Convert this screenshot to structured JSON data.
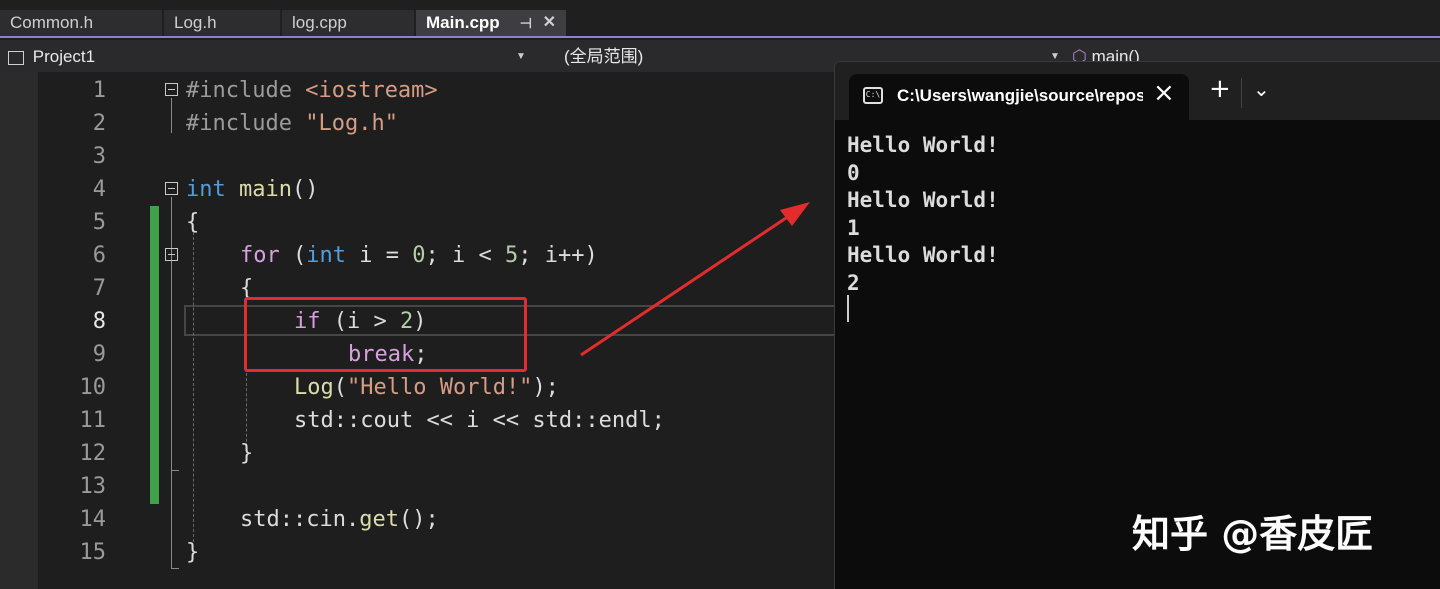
{
  "tabs": [
    {
      "label": "Common.h",
      "active": false
    },
    {
      "label": "Log.h",
      "active": false
    },
    {
      "label": "log.cpp",
      "active": false
    },
    {
      "label": "Main.cpp",
      "active": true
    }
  ],
  "nav": {
    "project": "Project1",
    "scope": "(全局范围)",
    "function": "main()"
  },
  "editor": {
    "line_numbers": [
      "1",
      "2",
      "3",
      "4",
      "5",
      "6",
      "7",
      "8",
      "9",
      "10",
      "11",
      "12",
      "13",
      "14",
      "15"
    ],
    "current_line": "8",
    "lines": {
      "l1": {
        "directive": "#include",
        "path": "<iostream>"
      },
      "l2": {
        "directive": "#include",
        "path": "\"Log.h\""
      },
      "l4": {
        "type": "int",
        "name": "main",
        "parens": "()"
      },
      "l5": {
        "brace": "{"
      },
      "l6": {
        "kw": "for",
        "open": "(",
        "type": "int",
        "rest1": " i = ",
        "n0": "0",
        "rest2": "; i < ",
        "n5": "5",
        "rest3": "; i++)"
      },
      "l7": {
        "brace": "{"
      },
      "l8": {
        "kw": "if",
        "rest1": " (i > ",
        "n2": "2",
        "close": ")"
      },
      "l9": {
        "kw": "break",
        "semi": ";"
      },
      "l10": {
        "fn": "Log",
        "open": "(",
        "str": "\"Hello World!\"",
        "close": ");"
      },
      "l11": {
        "text": "std::cout << i << std::endl;"
      },
      "l12": {
        "brace": "}"
      },
      "l14": {
        "prefix": "std::cin.",
        "fn": "get",
        "suffix": "();"
      },
      "l15": {
        "brace": "}"
      }
    }
  },
  "terminal": {
    "title": "C:\\Users\\wangjie\\source\\repos",
    "new_tab": "+",
    "close": "×",
    "dropdown": "⌄",
    "output": [
      "Hello World!",
      "0",
      "Hello World!",
      "1",
      "Hello World!",
      "2"
    ]
  },
  "watermark": "知乎 @香皮匠",
  "colors": {
    "keyword": "#569cd6",
    "control": "#d8a0df",
    "string": "#d69d85",
    "function": "#dcdcaa",
    "annotation_red": "#e42c2c",
    "change_bar": "#3fa14a"
  }
}
